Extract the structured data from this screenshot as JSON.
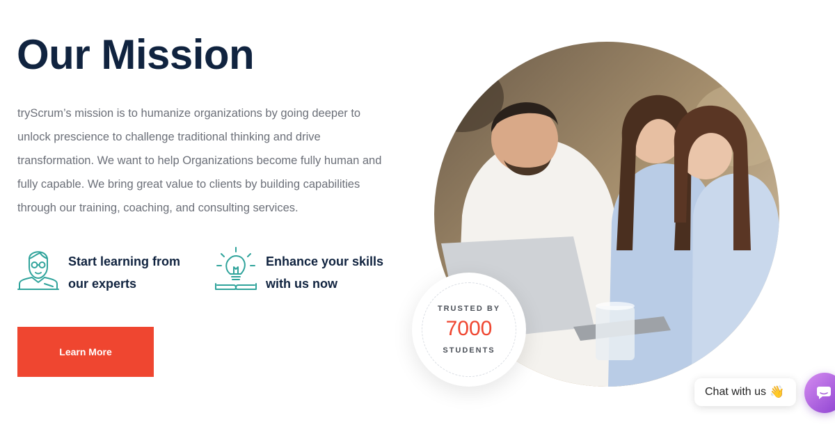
{
  "section": {
    "title": "Our Mission",
    "description": "tryScrum’s mission is to humanize organizations by going deeper to unlock prescience to challenge traditional thinking and drive transformation. We want to help Organizations become fully human and fully capable. We bring great value to clients by building capabilities through our training, coaching, and consulting services."
  },
  "features": [
    {
      "icon": "teacher-icon",
      "text": "Start learning from our experts"
    },
    {
      "icon": "lightbulb-book-icon",
      "text": "Enhance your skills with us now"
    }
  ],
  "cta": {
    "label": "Learn More"
  },
  "badge": {
    "top": "TRUSTED BY",
    "number": "7000",
    "bottom": "STUDENTS"
  },
  "chat": {
    "label": "Chat with us",
    "emoji": "👋"
  },
  "colors": {
    "heading": "#10233f",
    "accent": "#ef4630",
    "icon": "#2fa39b",
    "body_text": "#6b6f78",
    "chat_gradient": "#8a3fd0"
  }
}
